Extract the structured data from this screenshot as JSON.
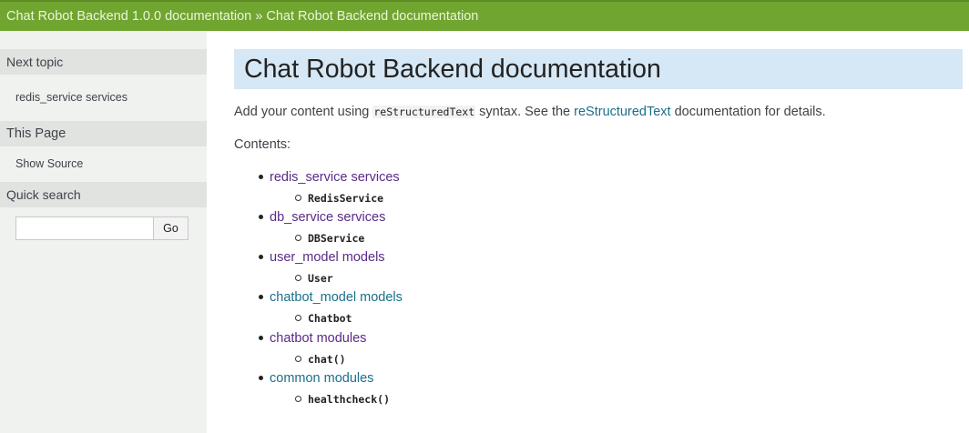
{
  "breadcrumb": {
    "root": "Chat Robot Backend 1.0.0 documentation",
    "separator": "»",
    "current": "Chat Robot Backend documentation"
  },
  "sidebar": {
    "next_topic_heading": "Next topic",
    "next_topic_link": "redis_service services",
    "this_page_heading": "This Page",
    "show_source": "Show Source",
    "quick_search_heading": "Quick search",
    "search_value": "",
    "search_button": "Go"
  },
  "main": {
    "title": "Chat Robot Backend documentation",
    "intro_before": "Add your content using ",
    "intro_code": "reStructuredText",
    "intro_middle": " syntax. See the ",
    "intro_link": "reStructuredText",
    "intro_after": " documentation for details.",
    "contents_label": "Contents:",
    "toc": [
      {
        "label": "redis_service services",
        "sub": "RedisService"
      },
      {
        "label": "db_service services",
        "sub": "DBService"
      },
      {
        "label": "user_model models",
        "sub": "User"
      },
      {
        "label": "chatbot_model models",
        "sub": "Chatbot"
      },
      {
        "label": "chatbot modules",
        "sub": "chat()"
      },
      {
        "label": "common modules",
        "sub": "healthcheck()"
      }
    ]
  },
  "colors": {
    "topbar": "#70a530",
    "title_bg": "#d6e7f5",
    "link": "#1a6f8a",
    "visited_link": "#5a2a86"
  }
}
